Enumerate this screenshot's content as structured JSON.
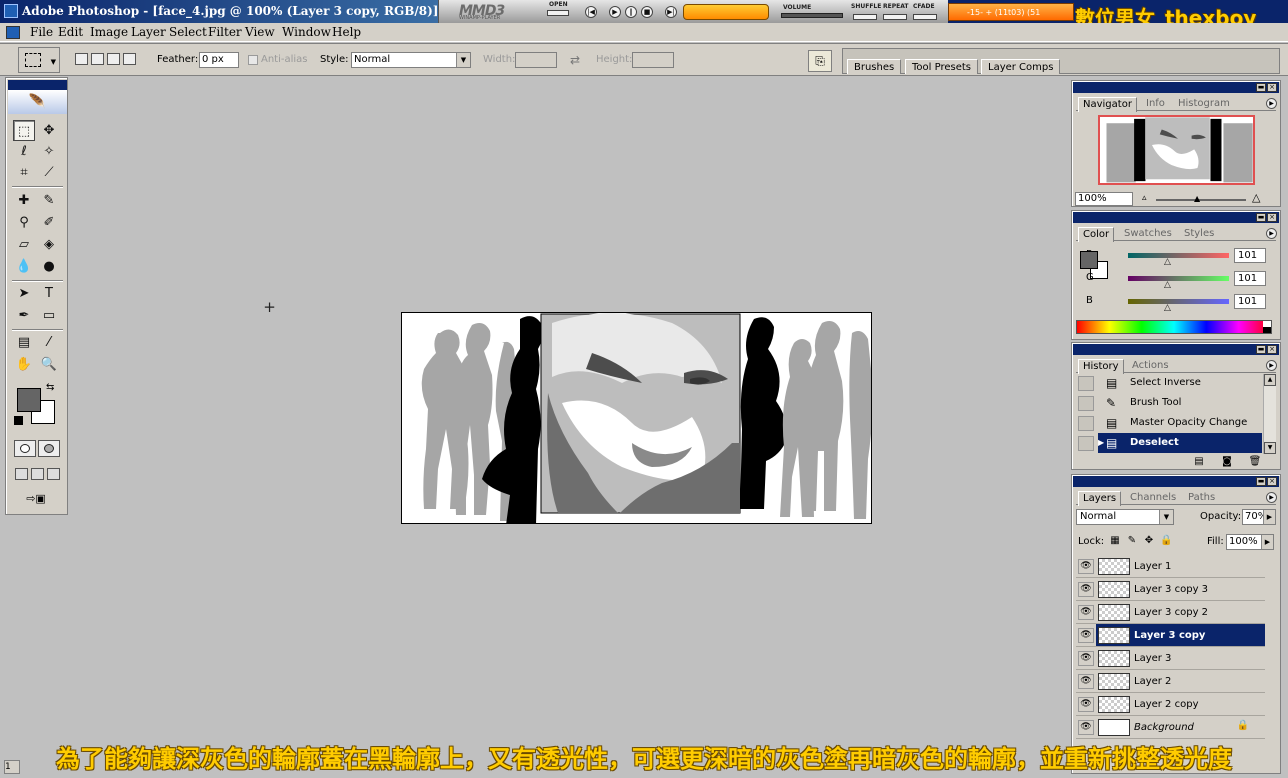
{
  "title_bar": {
    "title": "Adobe Photoshop - [face_4.jpg @ 100% (Layer 3 copy, RGB/8)]",
    "watermark": "數位男女_thexboy"
  },
  "player": {
    "logo": "MMD3",
    "sublogo": "WINAMP-PLAYER",
    "open_label": "OPEN",
    "volume_label": "VOLUME",
    "shuffle_label": "SHUFFLE",
    "repeat_label": "REPEAT",
    "cfade_label": "CFADE",
    "lcd_text": "-15-   +   (11t03) (51"
  },
  "menu": {
    "items": [
      "File",
      "Edit",
      "Image",
      "Layer",
      "Select",
      "Filter",
      "View",
      "Window",
      "Help"
    ]
  },
  "options": {
    "feather_label": "Feather:",
    "feather_value": "0 px",
    "antialias_label": "Anti-alias",
    "style_label": "Style:",
    "style_value": "Normal",
    "width_label": "Width:",
    "height_label": "Height:"
  },
  "palette_well": {
    "tabs": [
      "Brushes",
      "Tool Presets",
      "Layer Comps"
    ]
  },
  "navigator": {
    "tabs": [
      "Navigator",
      "Info",
      "Histogram"
    ],
    "zoom": "100%"
  },
  "color": {
    "tabs": [
      "Color",
      "Swatches",
      "Styles"
    ],
    "foreground": "#656565",
    "channels": [
      {
        "label": "R",
        "value": "101"
      },
      {
        "label": "G",
        "value": "101"
      },
      {
        "label": "B",
        "value": "101"
      }
    ]
  },
  "history": {
    "tabs": [
      "History",
      "Actions"
    ],
    "items": [
      {
        "label": "Select Inverse",
        "icon": "document-icon"
      },
      {
        "label": "Brush Tool",
        "icon": "brush-icon"
      },
      {
        "label": "Master Opacity Change",
        "icon": "document-icon"
      },
      {
        "label": "Deselect",
        "icon": "document-icon"
      }
    ],
    "selected": "Deselect"
  },
  "layers": {
    "tabs": [
      "Layers",
      "Channels",
      "Paths"
    ],
    "blend_mode": "Normal",
    "opacity_label": "Opacity:",
    "opacity": "70%",
    "lock_label": "Lock:",
    "fill_label": "Fill:",
    "fill": "100%",
    "items": [
      "Layer 1",
      "Layer 3 copy 3",
      "Layer 3 copy 2",
      "Layer 3 copy",
      "Layer 3",
      "Layer 2",
      "Layer 2 copy",
      "Background"
    ],
    "selected": "Layer 3 copy"
  },
  "subtitle": "為了能夠讓深灰色的輪廓蓋在黑輪廓上，又有透光性，可選更深暗的灰色塗再暗灰色的輪廓，並重新挑整透光度",
  "status": "1"
}
